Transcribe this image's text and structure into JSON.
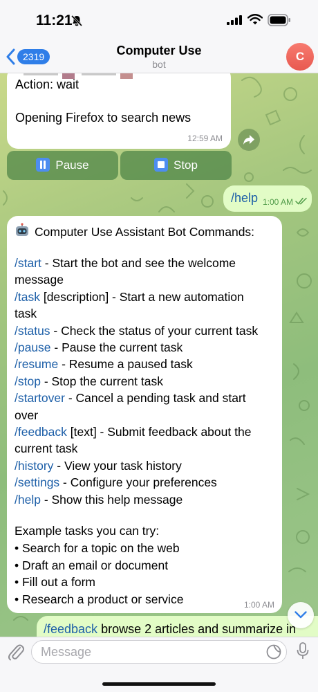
{
  "status_bar": {
    "time": "11:21"
  },
  "header": {
    "back_count": "2319",
    "title": "Computer Use",
    "subtitle": "bot",
    "avatar_letter": "C"
  },
  "messages": {
    "action_msg": {
      "action": "Action: wait",
      "text": "Opening Firefox to search news",
      "time": "12:59 AM"
    },
    "keyboard": {
      "pause_label": "Pause",
      "stop_label": "Stop"
    },
    "help_cmd": {
      "text": "/help",
      "time": "1:00 AM"
    },
    "help_reply": {
      "heading": "Computer Use Assistant Bot Commands:",
      "lines": [
        {
          "cmd": "/start",
          "text": " - Start the bot and see the welcome"
        },
        {
          "cmd": "",
          "text": "message"
        },
        {
          "cmd": "/task",
          "text": " [description] - Start a new automation"
        },
        {
          "cmd": "",
          "text": "task"
        },
        {
          "cmd": "/status",
          "text": " - Check the status of your current task"
        },
        {
          "cmd": "/pause",
          "text": " - Pause the current task"
        },
        {
          "cmd": "/resume",
          "text": " - Resume a paused task"
        },
        {
          "cmd": "/stop",
          "text": " - Stop the current task"
        },
        {
          "cmd": "/startover",
          "text": " - Cancel a pending task and start"
        },
        {
          "cmd": "",
          "text": "over"
        },
        {
          "cmd": "/feedback",
          "text": " [text] - Submit feedback about the"
        },
        {
          "cmd": "",
          "text": "current task"
        },
        {
          "cmd": "/history",
          "text": " - View your task history"
        },
        {
          "cmd": "/settings",
          "text": " - Configure your preferences"
        },
        {
          "cmd": "/help",
          "text": " - Show this help message"
        }
      ],
      "examples_heading": "Example tasks you can try:",
      "examples": [
        "• Search for a topic on the web",
        "• Draft an email or document",
        "• Fill out a form",
        "• Research a product or service"
      ],
      "time": "1:00 AM"
    },
    "feedback_msg": {
      "cmd": "/feedback",
      "text": " browse 2 articles and summarize in"
    }
  },
  "composer": {
    "placeholder": "Message"
  },
  "colors": {
    "accent": "#2f7ee8",
    "link": "#1d5fa8",
    "outgoing_bubble": "#e2fcc6",
    "avatar": "#e85950",
    "keyboard_button": "#4a8a48"
  },
  "icons": [
    "bell-slash-icon",
    "signal-icon",
    "wifi-icon",
    "battery-icon",
    "back-chevron-icon",
    "forward-icon",
    "pause-icon",
    "stop-icon",
    "read-checks-icon",
    "robot-icon",
    "chevron-down-icon",
    "attach-icon",
    "sticker-icon",
    "mic-icon"
  ]
}
